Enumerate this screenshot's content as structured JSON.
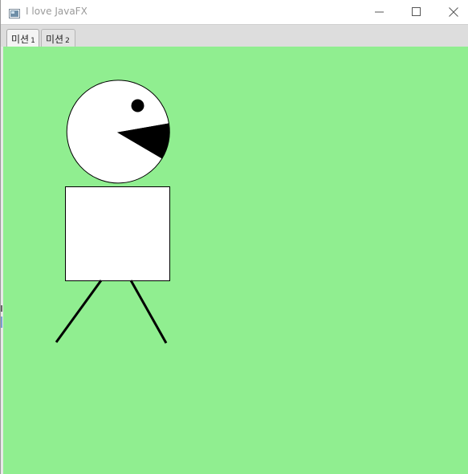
{
  "window": {
    "title": "I love JavaFX"
  },
  "tabs": [
    {
      "label": "미션",
      "number": "1",
      "selected": true
    },
    {
      "label": "미션",
      "number": "2",
      "selected": false
    }
  ],
  "scene": {
    "background": "#90ee90",
    "fill": "#ffffff",
    "stroke": "#000000"
  }
}
